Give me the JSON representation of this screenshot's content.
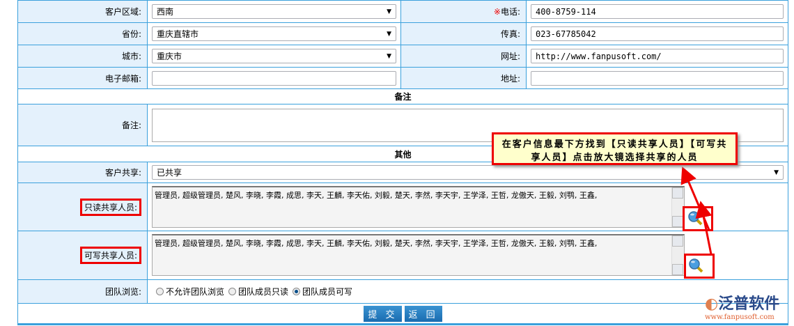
{
  "form": {
    "region": {
      "label": "客户区域:",
      "value": "西南"
    },
    "phone": {
      "required_mark": "※",
      "label": "电话:",
      "value": "400-8759-114"
    },
    "province": {
      "label": "省份:",
      "value": "重庆直辖市"
    },
    "fax": {
      "label": "传真:",
      "value": "023-67785042"
    },
    "city": {
      "label": "城市:",
      "value": "重庆市"
    },
    "website": {
      "label": "网址:",
      "value": "http://www.fanpusoft.com/"
    },
    "email": {
      "label": "电子邮箱:",
      "value": ""
    },
    "address": {
      "label": "地址:",
      "value": ""
    },
    "remarks_section": "备注",
    "remarks": {
      "label": "备注:",
      "value": ""
    },
    "other_section": "其他",
    "share": {
      "label": "客户共享:",
      "value": "已共享"
    },
    "readonly_share": {
      "label": "只读共享人员:",
      "value": "管理员, 超级管理员, 楚风, 李晓, 李霞, 成思, 李天, 王麟, 李天佑, 刘毅, 楚天, 李然, 李天宇, 王学泽, 王哲, 龙傲天, 王毅, 刘鹗, 王鑫,"
    },
    "writable_share": {
      "label": "可写共享人员:",
      "value": "管理员, 超级管理员, 楚风, 李晓, 李霞, 成思, 李天, 王麟, 李天佑, 刘毅, 楚天, 李然, 李天宇, 王学泽, 王哲, 龙傲天, 王毅, 刘鹗, 王鑫,"
    },
    "team_browse": {
      "label": "团队浏览:",
      "options": [
        "不允许团队浏览",
        "团队成员只读",
        "团队成员可写"
      ],
      "selected": "团队成员可写"
    }
  },
  "buttons": {
    "submit": "提 交",
    "back": "返 回"
  },
  "callout": {
    "text": "在客户信息最下方找到【只读共享人员】【可写共享人员】点击放大镜选择共享的人员"
  },
  "logo": {
    "name": "泛普软件",
    "url": "www.fanpusoft.com"
  },
  "colors": {
    "border": "#3aa0dc",
    "label_bg": "#e4f1fc",
    "highlight": "#ee0000",
    "button": "#1a6cb0"
  }
}
